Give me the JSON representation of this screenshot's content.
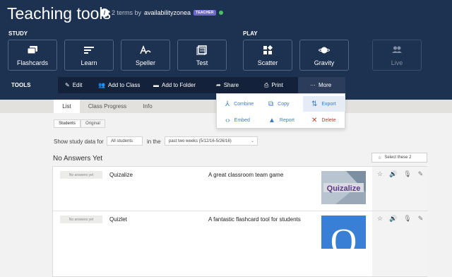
{
  "header": {
    "title": "Teaching tools",
    "terms_prefix": "2 terms by",
    "username": "availabilityzonea",
    "badge": "TEACHER"
  },
  "study": {
    "label": "STUDY",
    "modes": [
      "Flashcards",
      "Learn",
      "Speller",
      "Test"
    ]
  },
  "play": {
    "label": "PLAY",
    "modes": [
      "Scatter",
      "Gravity",
      "Live"
    ]
  },
  "tools": {
    "label": "TOOLS",
    "items": [
      "Edit",
      "Add to Class",
      "Add to Folder",
      "Share",
      "Print",
      "More"
    ]
  },
  "more_menu": [
    "Combine",
    "Copy",
    "Export",
    "Embed",
    "Report",
    "Delete"
  ],
  "tabs": [
    "List",
    "Class Progress",
    "Info"
  ],
  "toggle": [
    "Students",
    "Original"
  ],
  "filters": {
    "show_label": "Show study data for",
    "students_value": "All students",
    "in_label": "in the",
    "period_value": "past two weeks (5/12/16-5/26/16)"
  },
  "section_title": "No Answers Yet",
  "select_button": "Select these 2",
  "rows": [
    {
      "status": "No answers yet",
      "term": "Quizalize",
      "definition": "A great classroom team game",
      "image_text": "Quizalize"
    },
    {
      "status": "No answers yet",
      "term": "Quizlet",
      "definition": "A fantastic flashcard tool for students",
      "image_text": "Q"
    }
  ],
  "colors": {
    "header_bg": "#1d3150",
    "toolbar_bg": "#13223a",
    "link_blue": "#3f7bc1",
    "quizlet_blue": "#3a7fd6",
    "danger_red": "#c0392b"
  }
}
